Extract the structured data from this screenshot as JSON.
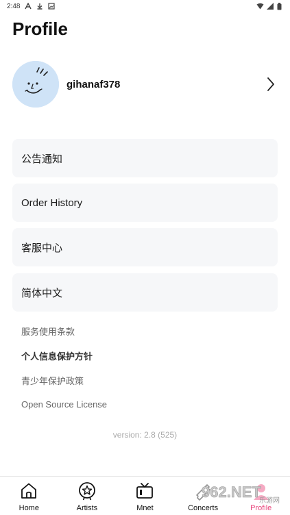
{
  "status_bar": {
    "time": "2:48",
    "icons": [
      "notification-a-icon",
      "download-icon",
      "image-icon",
      "wifi-icon",
      "signal-icon",
      "battery-icon"
    ]
  },
  "page": {
    "title": "Profile"
  },
  "profile": {
    "username": "gihanaf378",
    "avatar_color": "#cfe3f7"
  },
  "menu": [
    {
      "label": "公告通知"
    },
    {
      "label": "Order History"
    },
    {
      "label": "客服中心"
    },
    {
      "label": "简体中文"
    }
  ],
  "links": [
    {
      "label": "服务使用条款"
    },
    {
      "label": "个人信息保护方针"
    },
    {
      "label": "青少年保护政策"
    },
    {
      "label": "Open Source License"
    }
  ],
  "version": "version: 2.8 (525)",
  "bottom_nav": {
    "items": [
      {
        "label": "Home",
        "icon": "home-icon"
      },
      {
        "label": "Artists",
        "icon": "star-badge-icon"
      },
      {
        "label": "Mnet",
        "icon": "tv-icon"
      },
      {
        "label": "Concerts",
        "icon": "ticket-icon"
      },
      {
        "label": "Profile",
        "icon": "profile-icon"
      }
    ],
    "active_index": 4,
    "active_color": "#e8437a"
  },
  "watermark": {
    "text": "962.NET",
    "subtext": "乐游网"
  }
}
